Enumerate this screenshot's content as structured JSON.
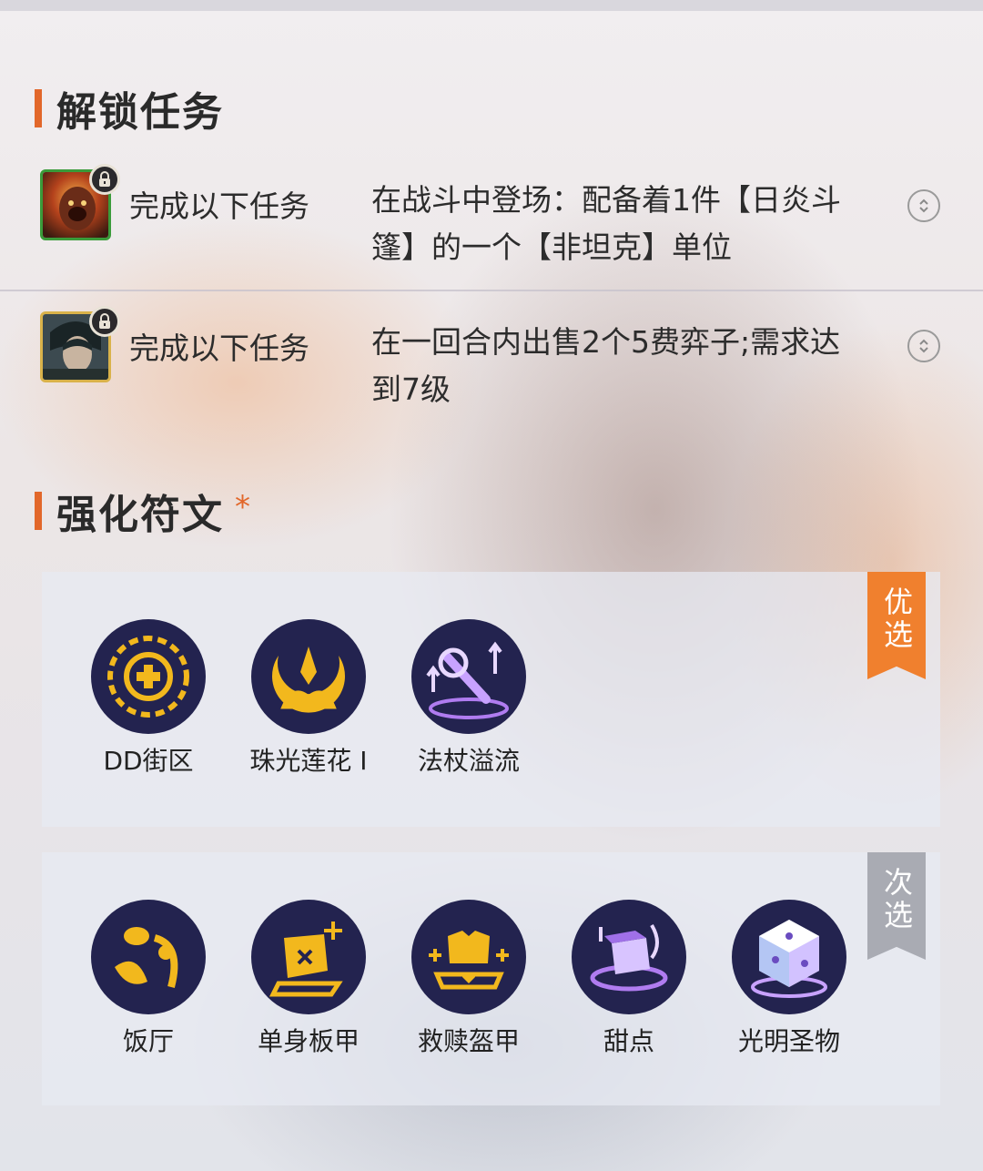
{
  "unlock_section": {
    "title": "解锁任务",
    "tasks": [
      {
        "label": "完成以下任务",
        "description": "在战斗中登场：配备着1件【日炎斗篷】的一个【非坦克】单位",
        "avatar_icon": "champion-avatar-icon",
        "lock_icon": "lock-icon"
      },
      {
        "label": "完成以下任务",
        "description": "在一回合内出售2个5费弈子;需求达到7级",
        "avatar_icon": "champion-avatar-icon",
        "lock_icon": "lock-icon"
      }
    ]
  },
  "rune_section": {
    "title": "强化符文",
    "required_mark": "*",
    "primary": {
      "tag": "优选",
      "items": [
        {
          "name": "DD街区",
          "icon": "dd-street-icon"
        },
        {
          "name": "珠光莲花 I",
          "icon": "pearl-lotus-icon"
        },
        {
          "name": "法杖溢流",
          "icon": "staff-overflow-icon"
        }
      ]
    },
    "secondary": {
      "tag": "次选",
      "items": [
        {
          "name": "饭厅",
          "icon": "dining-hall-icon"
        },
        {
          "name": "单身板甲",
          "icon": "single-plate-icon"
        },
        {
          "name": "救赎盔甲",
          "icon": "redemption-armor-icon"
        },
        {
          "name": "甜点",
          "icon": "dessert-icon"
        },
        {
          "name": "光明圣物",
          "icon": "radiant-relic-icon"
        }
      ]
    }
  },
  "colors": {
    "accent": "#e2672a",
    "primary_tag": "#f0802e",
    "secondary_tag": "#a9abb3",
    "rune_bg": "#23234f",
    "rune_gold": "#f2b81d"
  }
}
